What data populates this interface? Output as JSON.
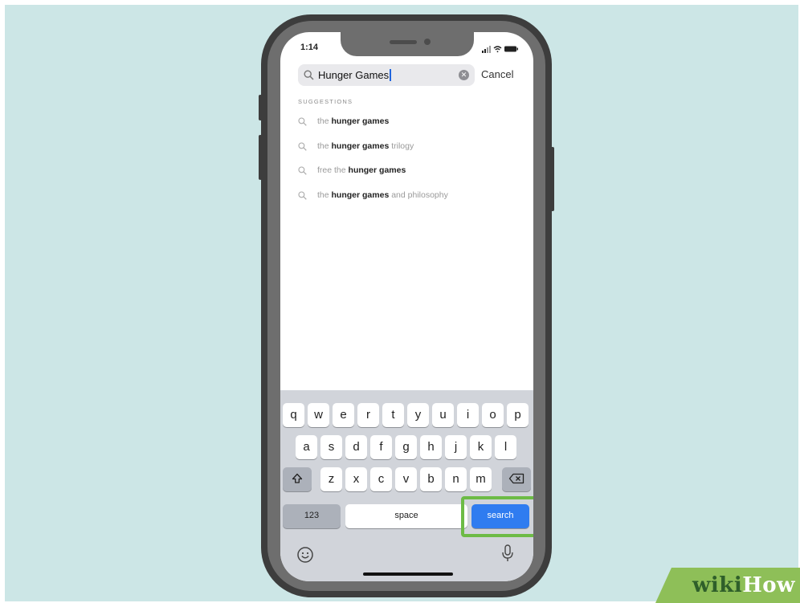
{
  "status_bar": {
    "time": "1:14"
  },
  "search": {
    "query": "Hunger Games",
    "cancel_label": "Cancel"
  },
  "suggestions": {
    "header": "SUGGESTIONS",
    "items": [
      {
        "pre": "the ",
        "bold": "hunger games",
        "post": ""
      },
      {
        "pre": "the ",
        "bold": "hunger games",
        "post": " trilogy"
      },
      {
        "pre": "free the ",
        "bold": "hunger games",
        "post": ""
      },
      {
        "pre": "the ",
        "bold": "hunger games",
        "post": " and philosophy"
      }
    ]
  },
  "keyboard": {
    "row1": [
      "q",
      "w",
      "e",
      "r",
      "t",
      "y",
      "u",
      "i",
      "o",
      "p"
    ],
    "row2": [
      "a",
      "s",
      "d",
      "f",
      "g",
      "h",
      "j",
      "k",
      "l"
    ],
    "row3": [
      "z",
      "x",
      "c",
      "v",
      "b",
      "n",
      "m"
    ],
    "numbers_label": "123",
    "space_label": "space",
    "search_label": "search"
  },
  "watermark": {
    "brand_part1": "wiki",
    "brand_part2": "How"
  },
  "colors": {
    "background": "#cce6e6",
    "search_key": "#2f7cf0",
    "highlight": "#6dbb46",
    "watermark_green": "#2f5f2a"
  },
  "icons": [
    "search-icon",
    "clear-icon",
    "shift-icon",
    "delete-icon",
    "emoji-icon",
    "mic-icon",
    "signal-icon",
    "wifi-icon",
    "battery-icon"
  ]
}
